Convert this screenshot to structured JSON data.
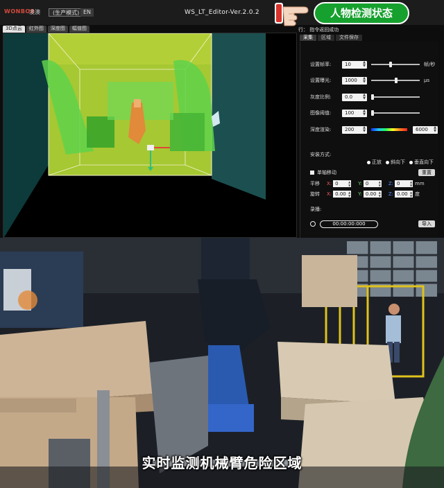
{
  "titlebar": {
    "logo": "WONBOR",
    "logo_sub": "凌澳",
    "mode_label": "(生产模式)",
    "lang_label": "EN",
    "window_title": "WS_LT_Editor-Ver.2.0.2"
  },
  "badge": {
    "text": "人物检测状态",
    "color": "#16a02e"
  },
  "view_tabs": [
    "3D点云",
    "红外图",
    "深度图",
    "幅值图"
  ],
  "status_line": "行：  指令返回成功",
  "panel_tabs": [
    "采集",
    "区域",
    "文件保存"
  ],
  "settings": {
    "frame_rate": {
      "label": "设置帧率:",
      "value": "10",
      "unit": "帧/秒"
    },
    "exposure": {
      "label": "设置曝光:",
      "value": "1000",
      "unit": "μs"
    },
    "gray_ratio": {
      "label": "灰度比例:",
      "value": "0.0"
    },
    "image_threshold": {
      "label": "图像阈值:",
      "value": "100"
    },
    "depth_render": {
      "label": "深度渲染:",
      "min": "200",
      "max": "6000"
    }
  },
  "install": {
    "label": "安装方式:",
    "options": [
      "正放",
      "斜向下",
      "垂直向下"
    ]
  },
  "move": {
    "single_step_label": "单轴移动",
    "reset_label": "重置",
    "translate_label": "平移",
    "rotate_label": "旋转",
    "translate": {
      "x": "0",
      "y": "0",
      "z": "0",
      "unit": "mm"
    },
    "rotate": {
      "x": "0.00",
      "y": "0.00",
      "z": "0.00",
      "unit": "度"
    }
  },
  "record": {
    "label": "录播:",
    "timer": "00:00:00:000",
    "import_label": "导入"
  },
  "caption": "实时监测机械臂危险区域",
  "colors": {
    "accent_green": "#16a02e",
    "axis_x": "#ff5a5a",
    "axis_y": "#6ad36a",
    "axis_z": "#5a8dff"
  }
}
